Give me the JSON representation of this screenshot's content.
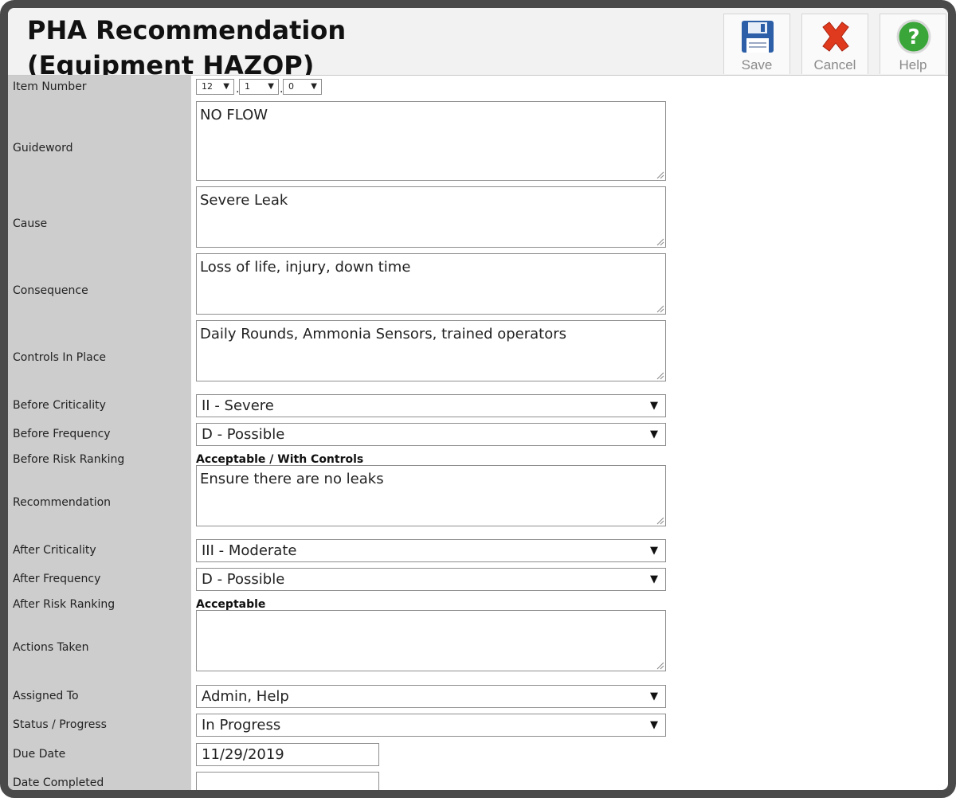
{
  "header": {
    "title_line1": "PHA Recommendation",
    "title_line2": "(Equipment HAZOP)"
  },
  "toolbar": {
    "save_label": "Save",
    "cancel_label": "Cancel",
    "help_label": "Help"
  },
  "labels": {
    "item_number": "Item Number",
    "guideword": "Guideword",
    "cause": "Cause",
    "consequence": "Consequence",
    "controls": "Controls In Place",
    "before_criticality": "Before Criticality",
    "before_frequency": "Before Frequency",
    "before_risk": "Before Risk Ranking",
    "recommendation": "Recommendation",
    "after_criticality": "After Criticality",
    "after_frequency": "After Frequency",
    "after_risk": "After Risk Ranking",
    "actions_taken": "Actions Taken",
    "assigned_to": "Assigned To",
    "status": "Status / Progress",
    "due_date": "Due Date",
    "date_completed": "Date Completed"
  },
  "values": {
    "item_number": [
      "12",
      "1",
      "0"
    ],
    "item_separator": ".",
    "arrow": "▼",
    "guideword": "NO FLOW",
    "cause": "Severe Leak",
    "consequence": "Loss of life, injury, down time",
    "controls": "Daily Rounds, Ammonia Sensors, trained operators",
    "before_criticality": "II - Severe",
    "before_frequency": "D - Possible",
    "before_risk": "Acceptable / With Controls",
    "recommendation": "Ensure there are no leaks",
    "after_criticality": "III - Moderate",
    "after_frequency": "D - Possible",
    "after_risk": "Acceptable",
    "actions_taken": "",
    "assigned_to": "Admin, Help",
    "status": "In Progress",
    "due_date": "11/29/2019",
    "date_completed": ""
  },
  "colors": {
    "label_column": "#cdcdcd",
    "cancel_icon": "#e03a1e",
    "help_icon": "#3aa63a",
    "save_icon": "#2c5fa8",
    "frame": "#4a4a4a"
  },
  "icons": [
    "save-icon",
    "cancel-icon",
    "help-icon"
  ]
}
